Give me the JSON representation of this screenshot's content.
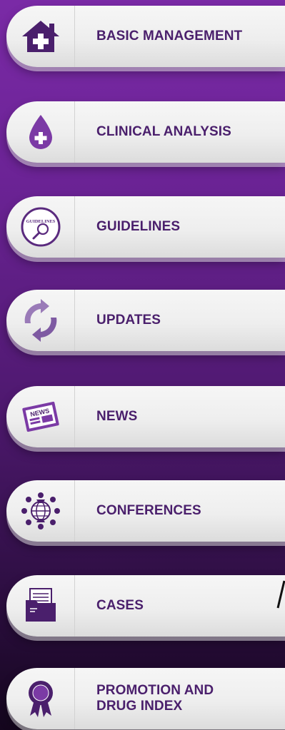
{
  "menu": {
    "items": [
      {
        "label": "BASIC MANAGEMENT",
        "icon": "home-plus-icon"
      },
      {
        "label": "CLINICAL ANALYSIS",
        "icon": "blood-drop-plus-icon"
      },
      {
        "label": "GUIDELINES",
        "icon": "guidelines-magnifier-icon"
      },
      {
        "label": "UPDATES",
        "icon": "refresh-arrows-icon"
      },
      {
        "label": "NEWS",
        "icon": "newspaper-icon"
      },
      {
        "label": "CONFERENCES",
        "icon": "conference-globe-icon"
      },
      {
        "label": "CASES",
        "icon": "folder-documents-icon"
      },
      {
        "label": "PROMOTION AND\nDRUG INDEX",
        "icon": "award-ribbon-icon"
      }
    ],
    "guidelines_badge_text": "GUIDELINES",
    "news_badge_text": "NEWS"
  },
  "colors": {
    "accent": "#4a1f6c",
    "icon_purple": "#7b3aa5",
    "background_top": "#7a2aa6",
    "background_bottom": "#14061d"
  }
}
